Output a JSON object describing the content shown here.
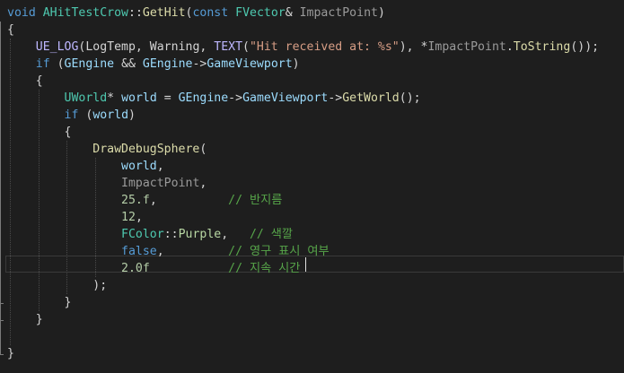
{
  "colors": {
    "background": "#1e1e1e",
    "keyword": "#569cd6",
    "type": "#4ec9b0",
    "function": "#dcdcaa",
    "macro": "#beb7ff",
    "parameter": "#9a9a9a",
    "variable": "#9cdcfe",
    "string": "#d69d85",
    "number": "#b5cea8",
    "comment": "#57a64a",
    "plain": "#d4d4d4",
    "enum": "#b8d7a3"
  },
  "code_lines": [
    [
      [
        "void",
        "keyword"
      ],
      [
        " ",
        "plain"
      ],
      [
        "AHitTestCrow",
        "type"
      ],
      [
        "::",
        "plain"
      ],
      [
        "GetHit",
        "function"
      ],
      [
        "(",
        "plain"
      ],
      [
        "const",
        "keyword"
      ],
      [
        " ",
        "plain"
      ],
      [
        "FVector",
        "type"
      ],
      [
        "& ",
        "plain"
      ],
      [
        "ImpactPoint",
        "parameter"
      ],
      [
        ")",
        "plain"
      ]
    ],
    [
      [
        "{",
        "plain"
      ]
    ],
    [
      [
        "    ",
        "plain"
      ],
      [
        "UE_LOG",
        "macro"
      ],
      [
        "(LogTemp, Warning, ",
        "plain"
      ],
      [
        "TEXT",
        "macro"
      ],
      [
        "(",
        "plain"
      ],
      [
        "\"Hit received at: %s\"",
        "string"
      ],
      [
        "), *",
        "plain"
      ],
      [
        "ImpactPoint",
        "parameter"
      ],
      [
        ".",
        "plain"
      ],
      [
        "ToString",
        "function"
      ],
      [
        "());",
        "plain"
      ]
    ],
    [
      [
        "    ",
        "plain"
      ],
      [
        "if",
        "keyword"
      ],
      [
        " (",
        "plain"
      ],
      [
        "GEngine",
        "variable"
      ],
      [
        " && ",
        "plain"
      ],
      [
        "GEngine",
        "variable"
      ],
      [
        "->",
        "plain"
      ],
      [
        "GameViewport",
        "variable"
      ],
      [
        ")",
        "plain"
      ]
    ],
    [
      [
        "    {",
        "plain"
      ]
    ],
    [
      [
        "        ",
        "plain"
      ],
      [
        "UWorld",
        "type"
      ],
      [
        "* ",
        "plain"
      ],
      [
        "world",
        "variable"
      ],
      [
        " = ",
        "plain"
      ],
      [
        "GEngine",
        "variable"
      ],
      [
        "->",
        "plain"
      ],
      [
        "GameViewport",
        "variable"
      ],
      [
        "->",
        "plain"
      ],
      [
        "GetWorld",
        "function"
      ],
      [
        "();",
        "plain"
      ]
    ],
    [
      [
        "        ",
        "plain"
      ],
      [
        "if",
        "keyword"
      ],
      [
        " (",
        "plain"
      ],
      [
        "world",
        "variable"
      ],
      [
        ")",
        "plain"
      ]
    ],
    [
      [
        "        {",
        "plain"
      ]
    ],
    [
      [
        "            ",
        "plain"
      ],
      [
        "DrawDebugSphere",
        "function"
      ],
      [
        "(",
        "plain"
      ]
    ],
    [
      [
        "                ",
        "plain"
      ],
      [
        "world",
        "variable"
      ],
      [
        ",",
        "plain"
      ]
    ],
    [
      [
        "                ",
        "plain"
      ],
      [
        "ImpactPoint",
        "parameter"
      ],
      [
        ",",
        "plain"
      ]
    ],
    [
      [
        "                ",
        "plain"
      ],
      [
        "25.f",
        "number"
      ],
      [
        ",          ",
        "plain"
      ],
      [
        "// 반지름",
        "comment"
      ]
    ],
    [
      [
        "                ",
        "plain"
      ],
      [
        "12",
        "number"
      ],
      [
        ",",
        "plain"
      ]
    ],
    [
      [
        "                ",
        "plain"
      ],
      [
        "FColor",
        "type"
      ],
      [
        "::",
        "plain"
      ],
      [
        "Purple",
        "enum"
      ],
      [
        ",   ",
        "plain"
      ],
      [
        "// 색깔",
        "comment"
      ]
    ],
    [
      [
        "                ",
        "plain"
      ],
      [
        "false",
        "keyword"
      ],
      [
        ",         ",
        "plain"
      ],
      [
        "// 영구 표시 여부",
        "comment"
      ]
    ],
    [
      [
        "                ",
        "plain"
      ],
      [
        "2.0f",
        "number"
      ],
      [
        "           ",
        "plain"
      ],
      [
        "// 지속 시간",
        "comment"
      ]
    ],
    [
      [
        "            );",
        "plain"
      ]
    ],
    [
      [
        "        }",
        "plain"
      ]
    ],
    [
      [
        "    }",
        "plain"
      ]
    ],
    [
      [
        "",
        "plain"
      ]
    ],
    [
      [
        "}",
        "plain"
      ]
    ]
  ]
}
